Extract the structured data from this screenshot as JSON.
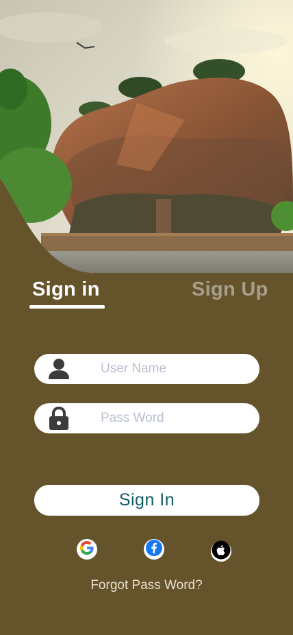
{
  "tabs": {
    "signin_label": "Sign in",
    "signup_label": "Sign Up"
  },
  "form": {
    "username_placeholder": "User Name",
    "username_value": "",
    "password_placeholder": "Pass Word",
    "password_value": "",
    "submit_label": "Sign In"
  },
  "social": [
    {
      "name": "google-icon"
    },
    {
      "name": "facebook-icon"
    },
    {
      "name": "apple-icon"
    }
  ],
  "forgot_label": "Forgot Pass Word?",
  "colors": {
    "background": "#65532b",
    "accent": "#115e66",
    "inactive_tab": "#a79f8c"
  }
}
